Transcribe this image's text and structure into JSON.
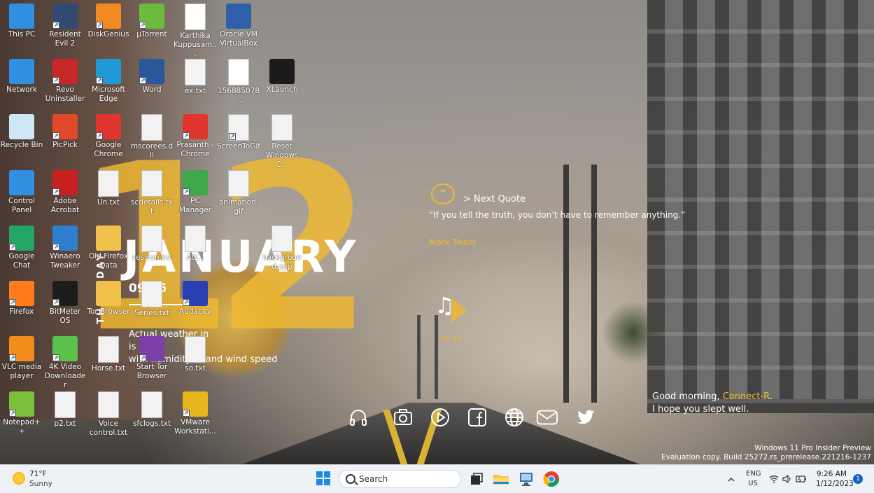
{
  "desktop_icons": [
    {
      "name": "this-pc",
      "label": "This PC",
      "color": "#2f8fe0",
      "shortcut": false
    },
    {
      "name": "resident-evil-2",
      "label": "Resident Evil 2",
      "color": "#324a72",
      "shortcut": true
    },
    {
      "name": "diskgenius",
      "label": "DiskGenius",
      "color": "#f18a22",
      "shortcut": true
    },
    {
      "name": "utorrent",
      "label": "µTorrent",
      "color": "#6dbb3b",
      "shortcut": true
    },
    {
      "name": "karthika-pdf",
      "label": "Karthika Kuppusam...",
      "color": "#ffffff",
      "shortcut": false
    },
    {
      "name": "oracle-vm",
      "label": "Oracle VM VirtualBox",
      "color": "#2f5fa8",
      "shortcut": false
    },
    {
      "name": "network",
      "label": "Network",
      "color": "#2f8fe0",
      "shortcut": false
    },
    {
      "name": "revo-uninstaller",
      "label": "Revo Uninstaller",
      "color": "#c62828",
      "shortcut": true
    },
    {
      "name": "microsoft-edge",
      "label": "Microsoft Edge",
      "color": "#1f9ad6",
      "shortcut": true
    },
    {
      "name": "word",
      "label": "Word",
      "color": "#2b579a",
      "shortcut": true
    },
    {
      "name": "ex-txt",
      "label": "ex.txt",
      "color": "#f4f4f4",
      "shortcut": false
    },
    {
      "name": "pdf-156885078",
      "label": "156885078_...",
      "color": "#ffffff",
      "shortcut": false
    },
    {
      "name": "xlaunch",
      "label": "XLaunch",
      "color": "#1b1b1b",
      "shortcut": false
    },
    {
      "name": "recycle-bin",
      "label": "Recycle Bin",
      "color": "#cfe6f7",
      "shortcut": false
    },
    {
      "name": "picpick",
      "label": "PicPick",
      "color": "#e04a2a",
      "shortcut": true
    },
    {
      "name": "google-chrome",
      "label": "Google Chrome",
      "color": "#e0342e",
      "shortcut": true
    },
    {
      "name": "mscorees-dll",
      "label": "mscorees.dll",
      "color": "#f2f2f2",
      "shortcut": false
    },
    {
      "name": "prasanth-chrome",
      "label": "Prasanth - Chrome",
      "color": "#e0342e",
      "shortcut": true
    },
    {
      "name": "screentogif",
      "label": "ScreenToGif",
      "color": "#f2f2f2",
      "shortcut": true
    },
    {
      "name": "reset-windows",
      "label": "Reset Windows C...",
      "color": "#f2f2f2",
      "shortcut": false
    },
    {
      "name": "control-panel",
      "label": "Control Panel",
      "color": "#2f8fe0",
      "shortcut": false
    },
    {
      "name": "adobe-acrobat",
      "label": "Adobe Acrobat",
      "color": "#c62020",
      "shortcut": true
    },
    {
      "name": "un-txt",
      "label": "Un.txt",
      "color": "#f2f2f2",
      "shortcut": false
    },
    {
      "name": "scdetails-txt",
      "label": "scdetails.txt",
      "color": "#f2f2f2",
      "shortcut": false
    },
    {
      "name": "pc-manager",
      "label": "PC Manager",
      "color": "#3ea84b",
      "shortcut": true
    },
    {
      "name": "animation-gif",
      "label": "animation.gif",
      "color": "#f2f2f2",
      "shortcut": false
    },
    {
      "name": "google-chat",
      "label": "Google Chat",
      "color": "#22a565",
      "shortcut": true
    },
    {
      "name": "winaero-tweaker",
      "label": "Winaero Tweaker",
      "color": "#2f7fd0",
      "shortcut": true
    },
    {
      "name": "old-firefox-data",
      "label": "Old Firefox Data",
      "color": "#f2c14b",
      "shortcut": false
    },
    {
      "name": "session-txt",
      "label": "session.txt",
      "color": "#f2f2f2",
      "shortcut": false
    },
    {
      "name": "att-file",
      "label": "Att...",
      "color": "#f2f2f2",
      "shortcut": false
    },
    {
      "name": "background-app",
      "label": "background.app",
      "color": "#f2f2f2",
      "shortcut": false
    },
    {
      "name": "firefox",
      "label": "Firefox",
      "color": "#ff7b1c",
      "shortcut": true
    },
    {
      "name": "bitmeter-os",
      "label": "BitMeter OS",
      "color": "#1c1c1c",
      "shortcut": true
    },
    {
      "name": "tor-browser",
      "label": "Tor Browser",
      "color": "#f2c14b",
      "shortcut": false
    },
    {
      "name": "series-txt",
      "label": "Series.txt",
      "color": "#f2f2f2",
      "shortcut": false
    },
    {
      "name": "audacity",
      "label": "Audacity",
      "color": "#2a3fb1",
      "shortcut": true
    },
    {
      "name": "vlc",
      "label": "VLC media player",
      "color": "#f28c1b",
      "shortcut": true
    },
    {
      "name": "4k-video-downloader",
      "label": "4K Video Downloader",
      "color": "#5cc04d",
      "shortcut": true
    },
    {
      "name": "horse-txt",
      "label": "Horse.txt",
      "color": "#f2f2f2",
      "shortcut": false
    },
    {
      "name": "start-tor-browser",
      "label": "Start Tor Browser",
      "color": "#7c3fa8",
      "shortcut": true
    },
    {
      "name": "so-txt",
      "label": "so.txt",
      "color": "#f2f2f2",
      "shortcut": false
    },
    {
      "name": "notepad-plus",
      "label": "Notepad++",
      "color": "#7bbf3b",
      "shortcut": true
    },
    {
      "name": "p2-txt",
      "label": "p2.txt",
      "color": "#f2f2f2",
      "shortcut": false
    },
    {
      "name": "voice-control-txt",
      "label": "Voice control.txt",
      "color": "#f2f2f2",
      "shortcut": false
    },
    {
      "name": "sfclogs-txt",
      "label": "sfclogs.txt",
      "color": "#f2f2f2",
      "shortcut": false
    },
    {
      "name": "vmware",
      "label": "VMware Workstati...",
      "color": "#e8b51c",
      "shortcut": true
    }
  ],
  "calendar": {
    "day": "12",
    "month": "JANUARY",
    "time": "09:26",
    "weekday": "THURSDAY",
    "weather_line1": "Actual weather in",
    "weather_line2": "is",
    "weather_line3": "with humidity % and wind speed"
  },
  "quote": {
    "next_label": "> Next Quote",
    "text": "“If you tell the truth, you don’t have to remember anything.”",
    "author": "Mark Twain",
    "icon": "quote-bubble-icon"
  },
  "music": {
    "icon": "music-note-icon",
    "time": "00:00"
  },
  "greeting": {
    "prefix": "Good morning, ",
    "name": "Connect-R",
    "suffix": ".",
    "line2": "I hope you slept well."
  },
  "social": [
    "headphones-icon",
    "camera-icon",
    "play-icon",
    "facebook-icon",
    "globe-icon",
    "mail-icon",
    "twitter-icon"
  ],
  "watermark": {
    "line1": "Windows 11 Pro Insider Preview",
    "line2": "Evaluation copy. Build 25272.rs_prerelease.221216-1237"
  },
  "taskbar": {
    "weather_temp": "71°F",
    "weather_cond": "Sunny",
    "search_label": "Search",
    "lang_line1": "ENG",
    "lang_line2": "US",
    "time": "9:26 AM",
    "date": "1/12/2023",
    "notification_count": "1",
    "accent": "#1e88e5"
  }
}
